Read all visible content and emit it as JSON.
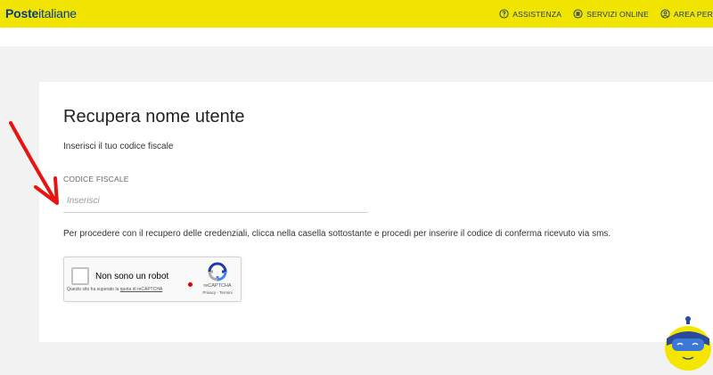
{
  "header": {
    "logo_bold": "Poste",
    "logo_rest": "italiane",
    "nav": [
      {
        "label": "ASSISTENZA",
        "icon": "help-circle-icon"
      },
      {
        "label": "SERVIZI ONLINE",
        "icon": "services-icon"
      },
      {
        "label": "AREA PER",
        "icon": "user-icon"
      }
    ],
    "bar_color": "#f0e400"
  },
  "form": {
    "title": "Recupera nome utente",
    "subtitle": "Inserisci il tuo codice fiscale",
    "field_label": "CODICE FISCALE",
    "field_placeholder": "Inserisci",
    "field_value": "",
    "instructions": "Per procedere con il recupero delle credenziali, clicca nella casella sottostante e procedi per inserire il codice di conferma ricevuto via sms."
  },
  "captcha": {
    "label": "Non sono un robot",
    "note_prefix": "Questo sito ha superato la ",
    "note_link": "quota di reCAPTCHA",
    "brand": "reCAPTCHA",
    "links": "Privacy - Termini",
    "checked": false
  },
  "annotation": {
    "arrow_color": "#e8140f"
  }
}
